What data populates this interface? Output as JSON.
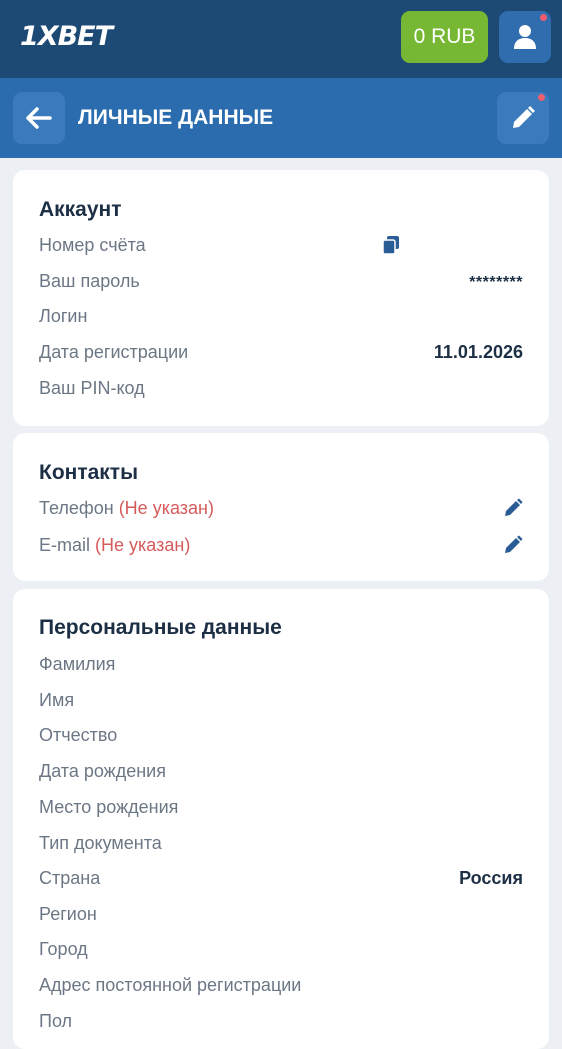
{
  "header": {
    "logo_text": "1XBET",
    "balance_label": "0 RUB",
    "colors": {
      "top": "#1c4a74",
      "sub": "#2b6cae",
      "balance": "#76b833"
    },
    "icons": {
      "profile": "user-icon",
      "back": "arrow-left-icon",
      "edit": "pencil-icon"
    }
  },
  "page": {
    "title": "ЛИЧНЫЕ ДАННЫЕ"
  },
  "account": {
    "title": "Аккаунт",
    "rows": [
      {
        "label": "Номер счёта",
        "value": ""
      },
      {
        "label": "Ваш пароль",
        "value": "********"
      },
      {
        "label": "Логин",
        "value": ""
      },
      {
        "label": "Дата регистрации",
        "value": "11.01.2026"
      },
      {
        "label": "Ваш PIN-код",
        "value": ""
      }
    ]
  },
  "contacts": {
    "title": "Контакты",
    "rows": [
      {
        "label": "Телефон",
        "status": "(Не указан)"
      },
      {
        "label": "E-mail",
        "status": "(Не указан)"
      }
    ]
  },
  "personal": {
    "title": "Персональные данные",
    "rows": [
      {
        "label": "Фамилия",
        "value": ""
      },
      {
        "label": "Имя",
        "value": ""
      },
      {
        "label": "Отчество",
        "value": ""
      },
      {
        "label": "Дата рождения",
        "value": ""
      },
      {
        "label": "Место рождения",
        "value": ""
      },
      {
        "label": "Тип документа",
        "value": ""
      },
      {
        "label": "Страна",
        "value": "Россия"
      },
      {
        "label": "Регион",
        "value": ""
      },
      {
        "label": "Город",
        "value": ""
      },
      {
        "label": "Адрес постоянной регистрации",
        "value": ""
      },
      {
        "label": "Пол",
        "value": ""
      }
    ]
  }
}
